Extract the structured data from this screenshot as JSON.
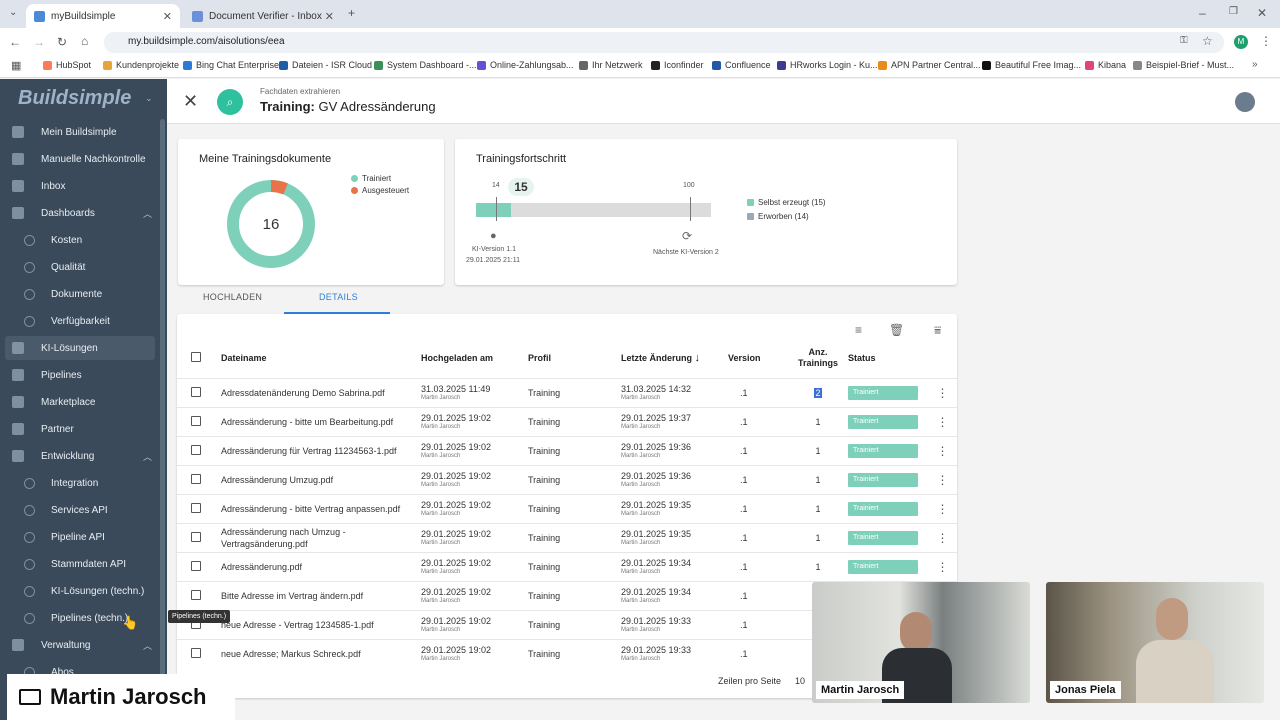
{
  "browser": {
    "tabs": [
      {
        "title": "myBuildsimple"
      },
      {
        "title": "Document Verifier - Inbox"
      }
    ],
    "url": "my.buildsimple.com/aisolutions/eea",
    "profile_initial": "M",
    "bookmarks": [
      "HubSpot",
      "Kundenprojekte",
      "Bing Chat Enterprise",
      "Dateien - ISR Cloud",
      "System Dashboard -...",
      "Online-Zahlungsab...",
      "Ihr Netzwerk",
      "Iconfinder",
      "Confluence",
      "HRworks Login - Ku...",
      "APN Partner Central...",
      "Beautiful Free Imag...",
      "Kibana",
      "Beispiel-Brief - Must..."
    ]
  },
  "sidebar": {
    "logo": "Buildsimple",
    "items": [
      {
        "label": "Mein Buildsimple"
      },
      {
        "label": "Manuelle Nachkontrolle"
      },
      {
        "label": "Inbox"
      },
      {
        "label": "Dashboards"
      },
      {
        "label": "Kosten"
      },
      {
        "label": "Qualität"
      },
      {
        "label": "Dokumente"
      },
      {
        "label": "Verfügbarkeit"
      },
      {
        "label": "KI-Lösungen"
      },
      {
        "label": "Pipelines"
      },
      {
        "label": "Marketplace"
      },
      {
        "label": "Partner"
      },
      {
        "label": "Entwicklung"
      },
      {
        "label": "Integration"
      },
      {
        "label": "Services API"
      },
      {
        "label": "Pipeline API"
      },
      {
        "label": "Stammdaten API"
      },
      {
        "label": "KI-Lösungen (techn.)"
      },
      {
        "label": "Pipelines (techn.)"
      },
      {
        "label": "Verwaltung"
      },
      {
        "label": "Abos"
      }
    ],
    "tooltip": "Pipelines (techn.)"
  },
  "header": {
    "subtitle": "Fachdaten extrahieren",
    "title_prefix": "Training:",
    "title": " GV Adressänderung"
  },
  "docs_card": {
    "title": "Meine Trainingsdokumente",
    "total": "16",
    "legend": [
      {
        "label": "Trainiert",
        "color": "#7ed0bb",
        "value": 15
      },
      {
        "label": "Ausgesteuert",
        "color": "#e8734a",
        "value": 1
      }
    ]
  },
  "progress_card": {
    "title": "Trainingsfortschritt",
    "marker_left": "14",
    "current": "15",
    "marker_right": "100",
    "progress_value": 15,
    "progress_max": 100,
    "left_caption_1": "KI-Version 1.1",
    "left_caption_2": "29.01.2025 21:11",
    "right_caption": "Nächste KI-Version 2",
    "legend": [
      {
        "label": "Selbst erzeugt (15)",
        "color": "#7ed0bb"
      },
      {
        "label": "Erworben (14)",
        "color": "#9aa8b8"
      }
    ]
  },
  "tabs": {
    "upload": "HOCHLADEN",
    "details": "DETAILS"
  },
  "table": {
    "headers": {
      "filename": "Dateiname",
      "uploaded": "Hochgeladen am",
      "profile": "Profil",
      "changed": "Letzte Änderung",
      "version": "Version",
      "trainings": "Anz. Trainings",
      "status": "Status"
    },
    "rows": [
      {
        "name": "Adressdatenänderung Demo Sabrina.pdf",
        "up": "31.03.2025 11:49",
        "up_by": "Martin Jarosch",
        "profile": "Training",
        "ch": "31.03.2025 14:32",
        "ch_by": "Martin Jarosch",
        "version": ".1",
        "count": "2",
        "status": "Trainiert"
      },
      {
        "name": "Adressänderung - bitte um Bearbeitung.pdf",
        "up": "29.01.2025 19:02",
        "up_by": "Martin Jarosch",
        "profile": "Training",
        "ch": "29.01.2025 19:37",
        "ch_by": "Martin Jarosch",
        "version": ".1",
        "count": "1",
        "status": "Trainiert"
      },
      {
        "name": "Adressänderung für Vertrag 11234563-1.pdf",
        "up": "29.01.2025 19:02",
        "up_by": "Martin Jarosch",
        "profile": "Training",
        "ch": "29.01.2025 19:36",
        "ch_by": "Martin Jarosch",
        "version": ".1",
        "count": "1",
        "status": "Trainiert"
      },
      {
        "name": "Adressänderung Umzug.pdf",
        "up": "29.01.2025 19:02",
        "up_by": "Martin Jarosch",
        "profile": "Training",
        "ch": "29.01.2025 19:36",
        "ch_by": "Martin Jarosch",
        "version": ".1",
        "count": "1",
        "status": "Trainiert"
      },
      {
        "name": "Adressänderung - bitte Vertrag anpassen.pdf",
        "up": "29.01.2025 19:02",
        "up_by": "Martin Jarosch",
        "profile": "Training",
        "ch": "29.01.2025 19:35",
        "ch_by": "Martin Jarosch",
        "version": ".1",
        "count": "1",
        "status": "Trainiert"
      },
      {
        "name": "Adressänderung nach Umzug - Vertragsänderung.pdf",
        "up": "29.01.2025 19:02",
        "up_by": "Martin Jarosch",
        "profile": "Training",
        "ch": "29.01.2025 19:35",
        "ch_by": "Martin Jarosch",
        "version": ".1",
        "count": "1",
        "status": "Trainiert"
      },
      {
        "name": "Adressänderung.pdf",
        "up": "29.01.2025 19:02",
        "up_by": "Martin Jarosch",
        "profile": "Training",
        "ch": "29.01.2025 19:34",
        "ch_by": "Martin Jarosch",
        "version": ".1",
        "count": "1",
        "status": "Trainiert"
      },
      {
        "name": "Bitte Adresse im Vertrag ändern.pdf",
        "up": "29.01.2025 19:02",
        "up_by": "Martin Jarosch",
        "profile": "Training",
        "ch": "29.01.2025 19:34",
        "ch_by": "Martin Jarosch",
        "version": ".1",
        "count": "1",
        "status": ""
      },
      {
        "name": "neue Adresse - Vertrag 1234585-1.pdf",
        "up": "29.01.2025 19:02",
        "up_by": "Martin Jarosch",
        "profile": "Training",
        "ch": "29.01.2025 19:33",
        "ch_by": "Martin Jarosch",
        "version": ".1",
        "count": "1",
        "status": ""
      },
      {
        "name": "neue Adresse; Markus Schreck.pdf",
        "up": "29.01.2025 19:02",
        "up_by": "Martin Jarosch",
        "profile": "Training",
        "ch": "29.01.2025 19:33",
        "ch_by": "Martin Jarosch",
        "version": ".1",
        "count": "1",
        "status": ""
      }
    ],
    "rows_per_page_label": "Zeilen pro Seite",
    "rows_per_page_value": "10"
  },
  "call": {
    "presenter": "Martin Jarosch",
    "participants": [
      "Martin Jarosch",
      "Jonas Piela"
    ]
  },
  "colors": {
    "accent": "#2fc09e",
    "trained": "#7ed0bb",
    "rejected": "#e8734a",
    "sidebar": "#3b4a5a",
    "link": "#2f7fd6"
  }
}
